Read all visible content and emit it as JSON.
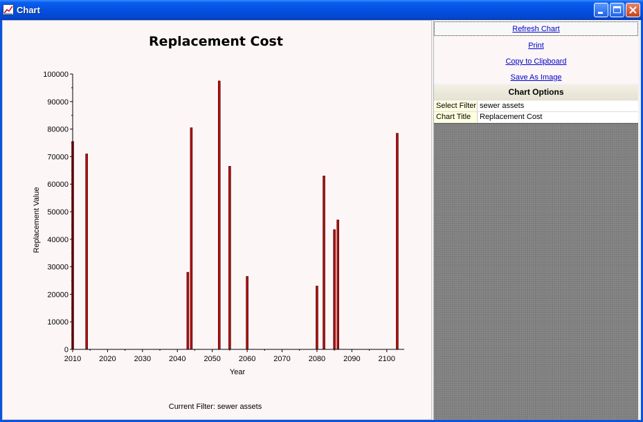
{
  "window": {
    "title": "Chart"
  },
  "sidebar": {
    "refresh_label": "Refresh Chart",
    "print_label": "Print",
    "copy_label": "Copy to Clipboard",
    "save_label": "Save As Image",
    "options_header": "Chart Options",
    "properties": [
      {
        "name": "Select Filter",
        "value": "sewer assets"
      },
      {
        "name": "Chart Title",
        "value": "Replacement Cost"
      }
    ]
  },
  "chart_data": {
    "type": "bar",
    "title": "Replacement Cost",
    "xlabel": "Year",
    "ylabel": "Replacement Value",
    "footer": "Current Filter: sewer assets",
    "xlim": [
      2010,
      2105
    ],
    "ylim": [
      0,
      100000
    ],
    "xticks": [
      2010,
      2020,
      2030,
      2040,
      2050,
      2060,
      2070,
      2080,
      2090,
      2100
    ],
    "yticks": [
      0,
      10000,
      20000,
      30000,
      40000,
      50000,
      60000,
      70000,
      80000,
      90000,
      100000
    ],
    "bar_color": "#B01010",
    "x": [
      2010,
      2014,
      2043,
      2044,
      2052,
      2055,
      2060,
      2080,
      2082,
      2085,
      2086,
      2103
    ],
    "values": [
      75500,
      71000,
      28000,
      80500,
      97500,
      66500,
      26500,
      23000,
      63000,
      43500,
      47000,
      78500
    ],
    "grid": false
  }
}
